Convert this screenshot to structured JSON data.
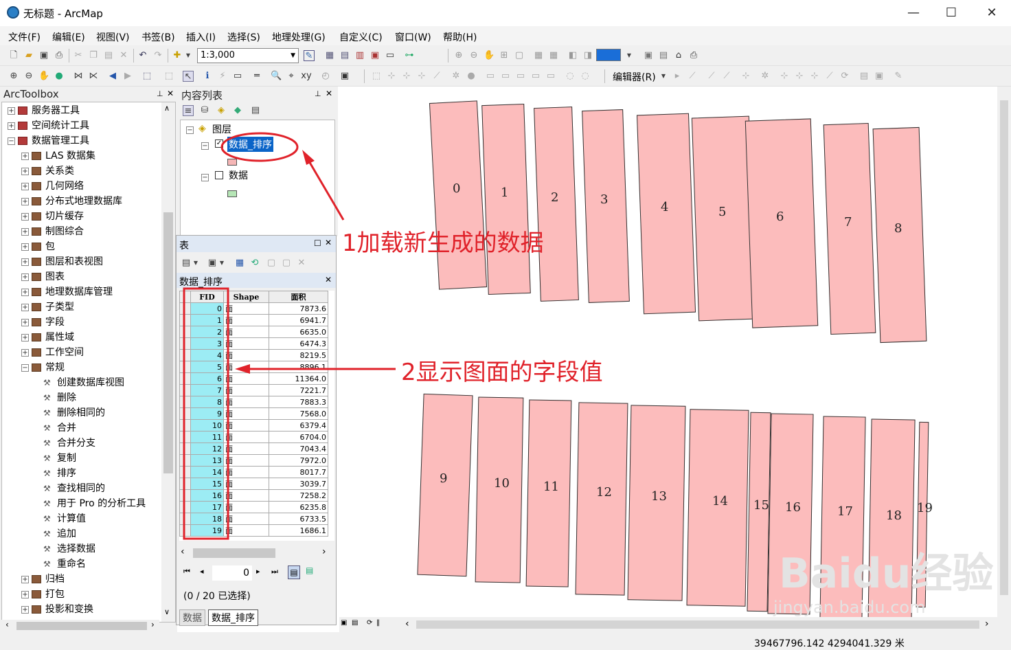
{
  "window": {
    "title": "无标题 - ArcMap"
  },
  "menu": [
    "文件(F)",
    "编辑(E)",
    "视图(V)",
    "书签(B)",
    "插入(I)",
    "选择(S)",
    "地理处理(G)",
    "自定义(C)",
    "窗口(W)",
    "帮助(H)"
  ],
  "toolbar": {
    "scale": "1:3,000",
    "editor_label": "编辑器(R)"
  },
  "arctoolbox": {
    "title": "ArcToolbox",
    "items": [
      {
        "label": "服务器工具",
        "level": 0,
        "expander": "+"
      },
      {
        "label": "空间统计工具",
        "level": 0,
        "expander": "+"
      },
      {
        "label": "数据管理工具",
        "level": 0,
        "expander": "−"
      },
      {
        "label": "LAS 数据集",
        "level": 1,
        "expander": "+"
      },
      {
        "label": "关系类",
        "level": 1,
        "expander": "+"
      },
      {
        "label": "几何网络",
        "level": 1,
        "expander": "+"
      },
      {
        "label": "分布式地理数据库",
        "level": 1,
        "expander": "+"
      },
      {
        "label": "切片缓存",
        "level": 1,
        "expander": "+"
      },
      {
        "label": "制图综合",
        "level": 1,
        "expander": "+"
      },
      {
        "label": "包",
        "level": 1,
        "expander": "+"
      },
      {
        "label": "图层和表视图",
        "level": 1,
        "expander": "+"
      },
      {
        "label": "图表",
        "level": 1,
        "expander": "+"
      },
      {
        "label": "地理数据库管理",
        "level": 1,
        "expander": "+"
      },
      {
        "label": "子类型",
        "level": 1,
        "expander": "+"
      },
      {
        "label": "字段",
        "level": 1,
        "expander": "+"
      },
      {
        "label": "属性域",
        "level": 1,
        "expander": "+"
      },
      {
        "label": "工作空间",
        "level": 1,
        "expander": "+"
      },
      {
        "label": "常规",
        "level": 1,
        "expander": "−"
      },
      {
        "label": "创建数据库视图",
        "level": 2
      },
      {
        "label": "删除",
        "level": 2
      },
      {
        "label": "删除相同的",
        "level": 2
      },
      {
        "label": "合并",
        "level": 2
      },
      {
        "label": "合并分支",
        "level": 2
      },
      {
        "label": "复制",
        "level": 2
      },
      {
        "label": "排序",
        "level": 2
      },
      {
        "label": "查找相同的",
        "level": 2
      },
      {
        "label": "用于 Pro 的分析工具",
        "level": 2
      },
      {
        "label": "计算值",
        "level": 2
      },
      {
        "label": "追加",
        "level": 2
      },
      {
        "label": "选择数据",
        "level": 2
      },
      {
        "label": "重命名",
        "level": 2
      },
      {
        "label": "归档",
        "level": 1,
        "expander": "+"
      },
      {
        "label": "打包",
        "level": 1,
        "expander": "+"
      },
      {
        "label": "投影和变换",
        "level": 1,
        "expander": "+"
      }
    ]
  },
  "toc": {
    "title": "内容列表",
    "group": "图层",
    "layers": [
      {
        "name": "数据_排序",
        "checked": true,
        "color": "#f5b6b6"
      },
      {
        "name": "数据",
        "checked": false,
        "color": "#b6e6b6"
      }
    ]
  },
  "table_window": {
    "title": "表",
    "table_name": "数据_排序",
    "columns": [
      "FID",
      "Shape",
      "面积"
    ],
    "rows": [
      [
        "0",
        "面",
        "7873.6"
      ],
      [
        "1",
        "面",
        "6941.7"
      ],
      [
        "2",
        "面",
        "6635.0"
      ],
      [
        "3",
        "面",
        "6474.3"
      ],
      [
        "4",
        "面",
        "8219.5"
      ],
      [
        "5",
        "面",
        "8896.1"
      ],
      [
        "6",
        "面",
        "11364.0"
      ],
      [
        "7",
        "面",
        "7221.7"
      ],
      [
        "8",
        "面",
        "7883.3"
      ],
      [
        "9",
        "面",
        "7568.0"
      ],
      [
        "10",
        "面",
        "6379.4"
      ],
      [
        "11",
        "面",
        "6704.0"
      ],
      [
        "12",
        "面",
        "7043.4"
      ],
      [
        "13",
        "面",
        "7972.0"
      ],
      [
        "14",
        "面",
        "8017.7"
      ],
      [
        "15",
        "面",
        "3039.7"
      ],
      [
        "16",
        "面",
        "7258.2"
      ],
      [
        "17",
        "面",
        "6235.8"
      ],
      [
        "18",
        "面",
        "6733.5"
      ],
      [
        "19",
        "面",
        "1686.1"
      ]
    ],
    "record": "0",
    "selection_status": "(0 / 20 已选择)",
    "tabs": [
      "数据",
      "数据_排序"
    ]
  },
  "map": {
    "labels": [
      "0",
      "1",
      "2",
      "3",
      "4",
      "5",
      "6",
      "7",
      "8",
      "9",
      "10",
      "11",
      "12",
      "13",
      "14",
      "15",
      "16",
      "17",
      "18",
      "19"
    ],
    "fill": "#fcbcbc"
  },
  "annotations": {
    "a1": "1加载新生成的数据",
    "a2": "2显示图面的字段值",
    "color": "#e0222a"
  },
  "watermark": {
    "brand": "Baidu经验",
    "url": "jingyan.baidu.com"
  },
  "status": {
    "coords": "39467796.142  4294041.329 米"
  }
}
